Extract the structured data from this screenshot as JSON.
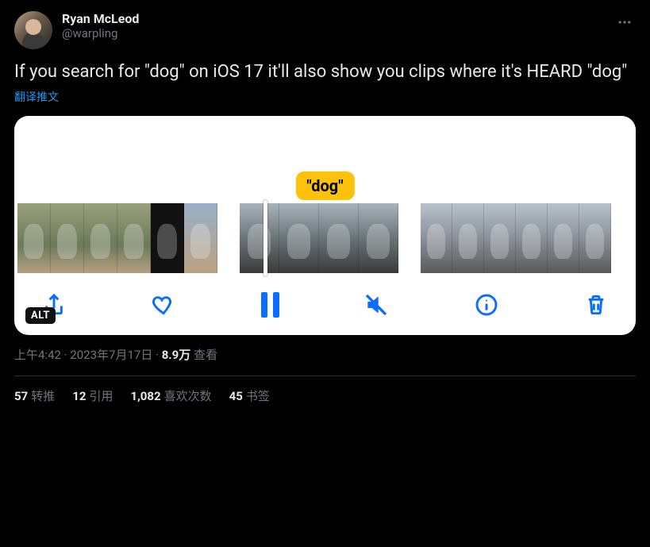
{
  "author": {
    "display_name": "Ryan McLeod",
    "handle": "@warpling"
  },
  "text": "If you search for \"dog\" on iOS 17 it'll also show you clips where it's HEARD \"dog\"",
  "translate_label": "翻译推文",
  "media": {
    "search_tag": "\"dog\"",
    "alt_badge": "ALT",
    "toolbar": {
      "share": "share-icon",
      "like": "heart-icon",
      "pause": "pause-icon",
      "mute": "muted-icon",
      "info": "info-icon",
      "delete": "trash-icon"
    }
  },
  "meta": {
    "time": "上午4:42",
    "date": "2023年7月17日",
    "views_count": "8.9万",
    "views_label": "查看"
  },
  "stats": {
    "retweets": {
      "count": "57",
      "label": "转推"
    },
    "quotes": {
      "count": "12",
      "label": "引用"
    },
    "likes": {
      "count": "1,082",
      "label": "喜欢次数"
    },
    "bookmarks": {
      "count": "45",
      "label": "书签"
    }
  }
}
